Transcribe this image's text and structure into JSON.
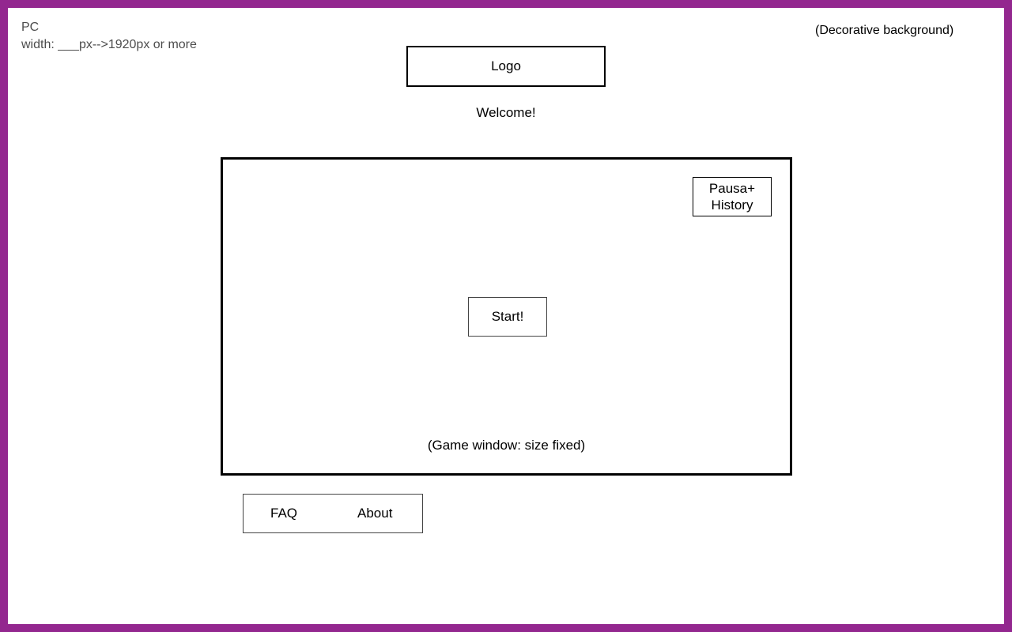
{
  "colors": {
    "accent": "#93278f"
  },
  "note": {
    "line1": "PC",
    "line2": "width: ___px-->1920px or more"
  },
  "background_label": "(Decorative background)",
  "header": {
    "logo": "Logo",
    "welcome": "Welcome!"
  },
  "game": {
    "pause_line1": "Pausa+",
    "pause_line2": "History",
    "start": "Start!",
    "caption": "(Game window: size fixed)"
  },
  "footer": {
    "faq": "FAQ",
    "about": "About"
  }
}
